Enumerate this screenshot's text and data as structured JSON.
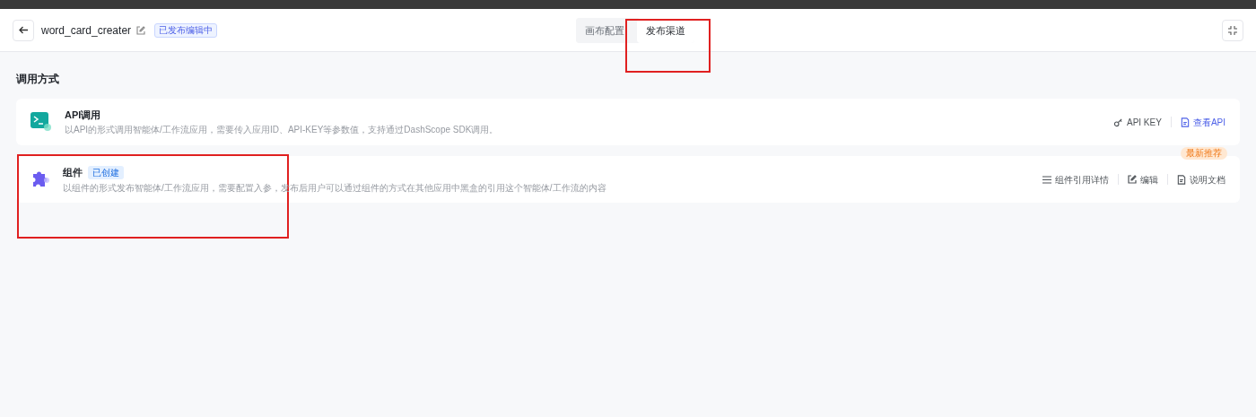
{
  "header": {
    "app_name": "word_card_creater",
    "status_badge": "已发布编辑中",
    "tabs": [
      {
        "label": "画布配置",
        "selected": false
      },
      {
        "label": "发布渠道",
        "selected": true
      }
    ]
  },
  "section_title": "调用方式",
  "channels": [
    {
      "kind": "api",
      "title": "API调用",
      "description": "以API的形式调用智能体/工作流应用，需要传入应用ID、API-KEY等参数值，支持通过DashScope SDK调用。",
      "actions": [
        {
          "kind": "key",
          "label": "API KEY",
          "primary": false
        },
        {
          "kind": "doc",
          "label": "查看API",
          "primary": true
        }
      ]
    },
    {
      "kind": "component",
      "title": "组件",
      "badge": "已创建",
      "ribbon": "最新推荐",
      "description": "以组件的形式发布智能体/工作流应用，需要配置入参，发布后用户可以通过组件的方式在其他应用中黑盒的引用这个智能体/工作流的内容",
      "actions": [
        {
          "kind": "list",
          "label": "组件引用详情",
          "primary": false
        },
        {
          "kind": "edit",
          "label": "编辑",
          "primary": false
        },
        {
          "kind": "doc",
          "label": "说明文档",
          "primary": false
        }
      ]
    }
  ]
}
